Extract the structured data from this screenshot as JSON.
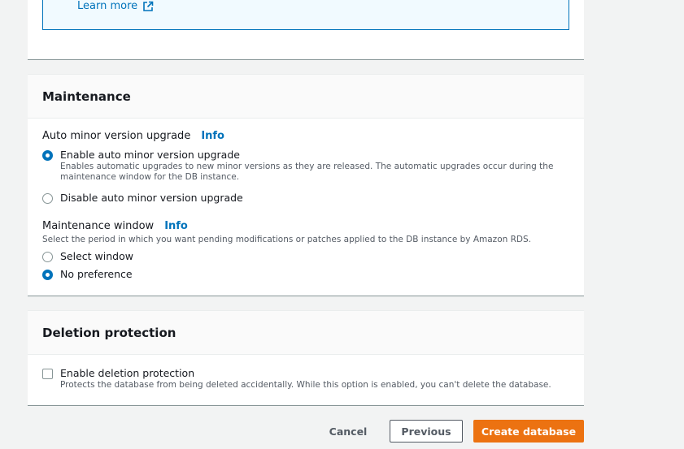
{
  "info_box": {
    "learn_more": "Learn more"
  },
  "maintenance": {
    "title": "Maintenance",
    "auto_minor": {
      "label": "Auto minor version upgrade",
      "info": "Info",
      "options": [
        {
          "label": "Enable auto minor version upgrade",
          "desc": "Enables automatic upgrades to new minor versions as they are released. The automatic upgrades occur during the maintenance window for the DB instance.",
          "checked": true
        },
        {
          "label": "Disable auto minor version upgrade",
          "checked": false
        }
      ]
    },
    "window": {
      "label": "Maintenance window",
      "info": "Info",
      "desc": "Select the period in which you want pending modifications or patches applied to the DB instance by Amazon RDS.",
      "options": [
        {
          "label": "Select window",
          "checked": false
        },
        {
          "label": "No preference",
          "checked": true
        }
      ]
    }
  },
  "deletion": {
    "title": "Deletion protection",
    "option": {
      "label": "Enable deletion protection",
      "desc": "Protects the database from being deleted accidentally. While this option is enabled, you can't delete the database.",
      "checked": false
    }
  },
  "actions": {
    "cancel": "Cancel",
    "previous": "Previous",
    "create": "Create database"
  },
  "colors": {
    "accent": "#0073bb",
    "primary_button": "#ec7211"
  }
}
